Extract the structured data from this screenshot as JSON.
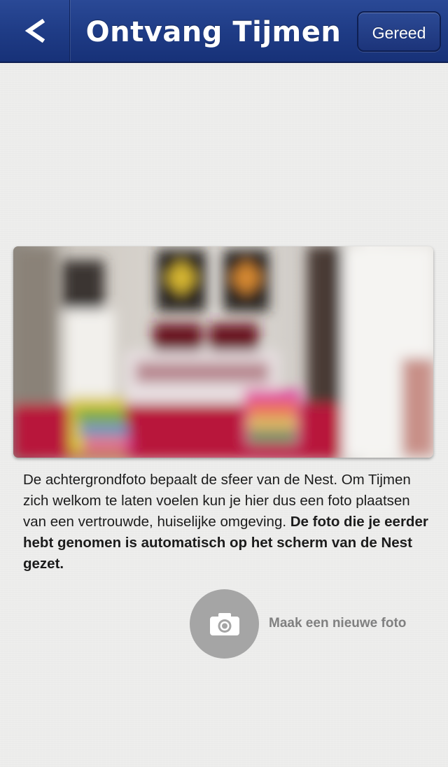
{
  "navbar": {
    "back_label": "<",
    "title": "Ontvang Tijmen",
    "done_label": "Gereed"
  },
  "colors": {
    "navbar": "#1f3c86",
    "background": "#ededec",
    "camera_button": "#a5a5a5"
  },
  "photo": {
    "description": "blurred bedroom background photo"
  },
  "description": {
    "normal_text": "De achtergrondfoto bepaalt de sfeer van de Nest. Om Tijmen zich welkom te laten voelen kun je hier dus een foto plaatsen van een vertrouwde, huiselijke omgeving.",
    "bold_text": "De foto die je eerder hebt genomen is automatisch op het scherm van de Nest gezet."
  },
  "camera": {
    "icon": "camera-icon",
    "label": "Maak een nieuwe foto"
  }
}
